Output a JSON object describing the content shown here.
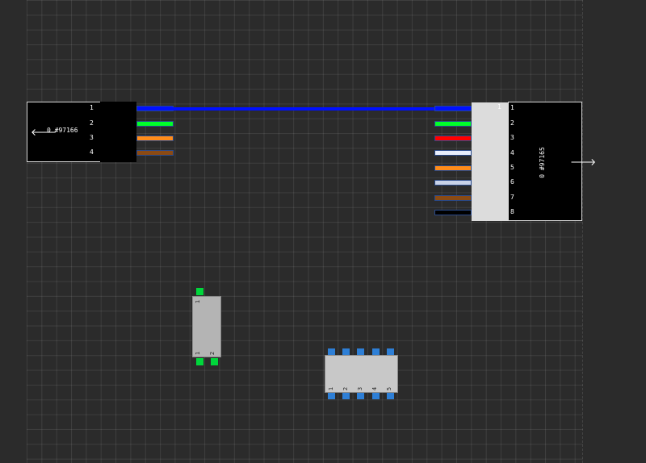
{
  "left_connector": {
    "id_label": "0 #97166",
    "pins": [
      "1",
      "2",
      "3",
      "4"
    ],
    "icon": "arrow-left-icon",
    "wire_colors": [
      "#0010ff",
      "#00ff2a",
      "#ff8c1a",
      "#8a4a14"
    ]
  },
  "right_connector": {
    "id_label": "0 #97165",
    "housing_pin": "1",
    "pins": [
      "1",
      "2",
      "3",
      "4",
      "5",
      "6",
      "7",
      "8"
    ],
    "icon": "arrow-right-icon",
    "wire_colors": [
      "#0010ff",
      "#00ff2a",
      "#ff0000",
      "#e8eefc",
      "#ff8c1a",
      "#c8d2e8",
      "#8a4a14",
      "#000000"
    ]
  },
  "resistor": {
    "pins": [
      "1",
      "1",
      "2"
    ]
  },
  "ic": {
    "pins": [
      "1",
      "2",
      "3",
      "4",
      "5"
    ]
  }
}
